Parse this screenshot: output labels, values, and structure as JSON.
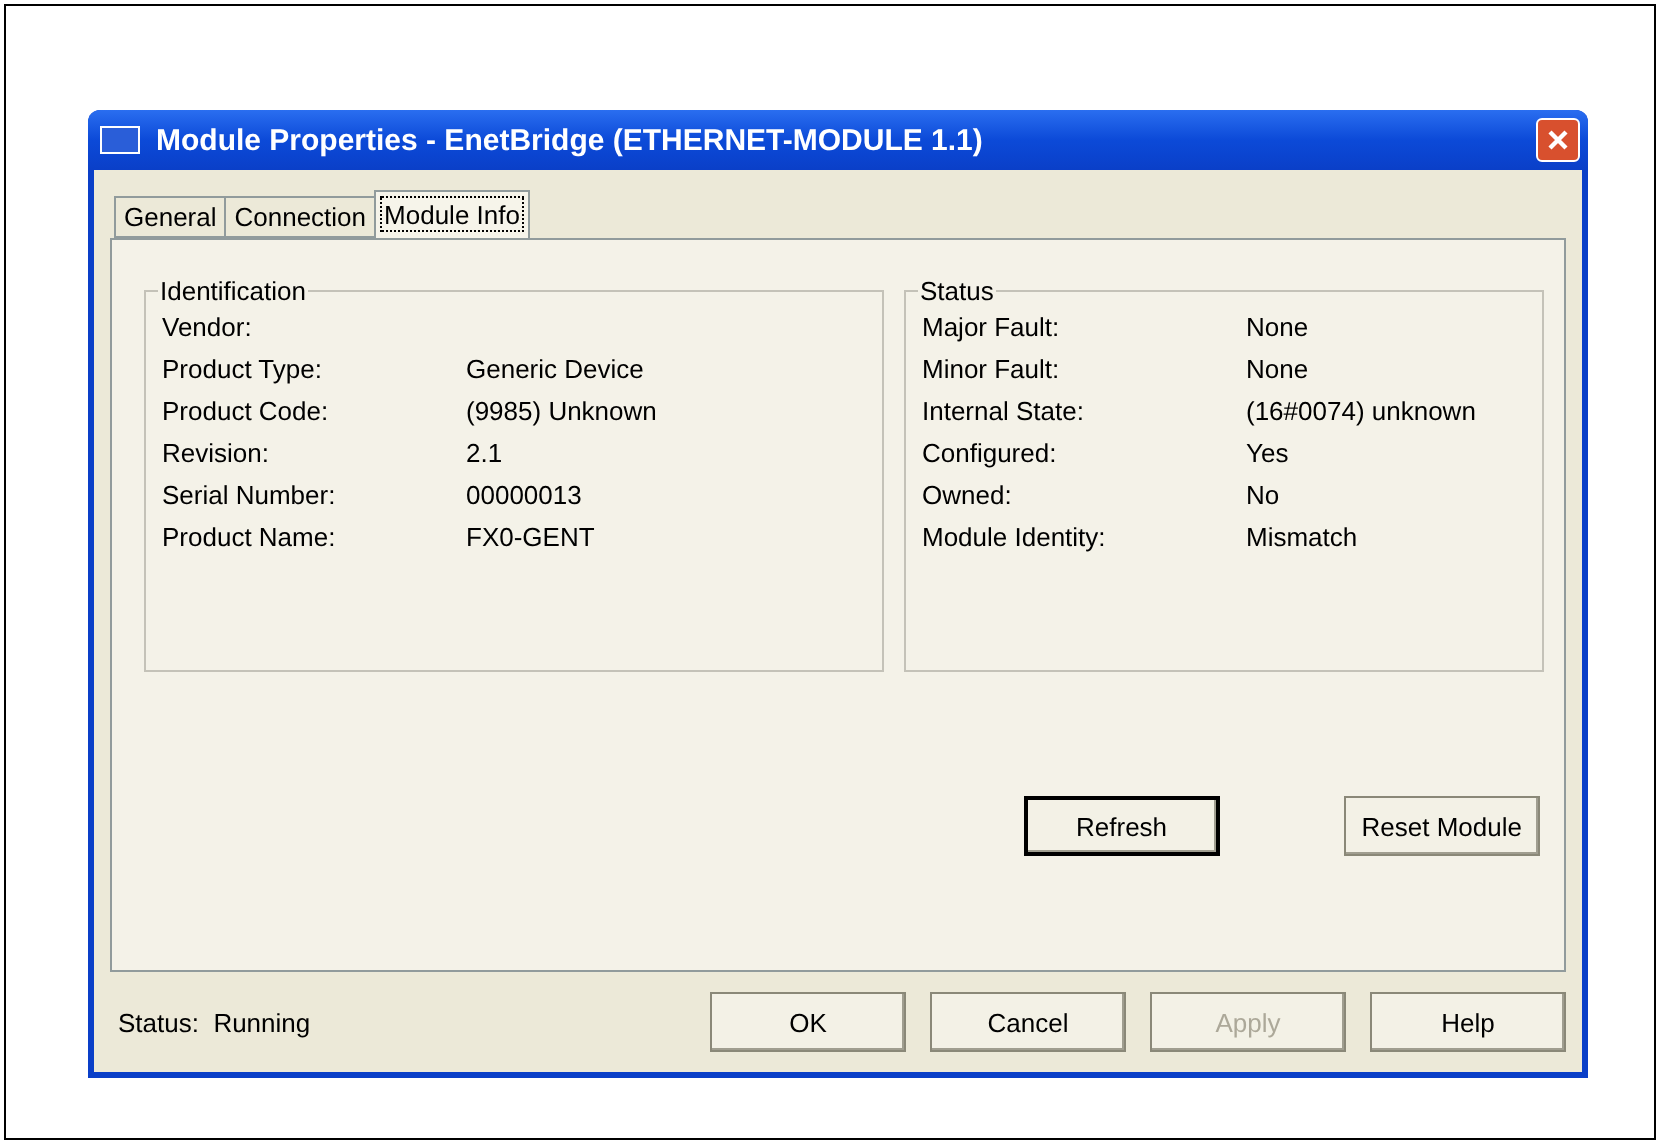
{
  "window": {
    "title": "Module Properties  - EnetBridge (ETHERNET-MODULE 1.1)"
  },
  "tabs": [
    {
      "label": "General",
      "selected": false
    },
    {
      "label": "Connection",
      "selected": false
    },
    {
      "label": "Module Info",
      "selected": true
    }
  ],
  "identification": {
    "title": "Identification",
    "rows": [
      {
        "label": "Vendor:"
      },
      {
        "label": "Product Type:",
        "value": "Generic Device"
      },
      {
        "label": "Product Code:",
        "value": "(9985) Unknown"
      },
      {
        "label": "Revision:",
        "value": "2.1"
      },
      {
        "label": "Serial Number:",
        "value": "00000013"
      },
      {
        "label": "Product Name:",
        "value": "FX0-GENT"
      }
    ]
  },
  "status": {
    "title": "Status",
    "rows": [
      {
        "label": "Major Fault:",
        "value": "None"
      },
      {
        "label": "Minor Fault:",
        "value": "None"
      },
      {
        "label": "Internal State:",
        "value": "(16#0074) unknown"
      },
      {
        "label": "Configured:",
        "value": "Yes"
      },
      {
        "label": "Owned:",
        "value": "No"
      },
      {
        "label": "Module Identity:",
        "value": "Mismatch"
      }
    ]
  },
  "module_buttons": [
    {
      "label": "Refresh",
      "default": true
    },
    {
      "label": "Reset Module",
      "default": false
    }
  ],
  "status_bar": "Status:  Running",
  "buttons": [
    {
      "label": "OK",
      "disabled": false
    },
    {
      "label": "Cancel",
      "disabled": false
    },
    {
      "label": "Apply",
      "disabled": true
    },
    {
      "label": "Help",
      "disabled": false
    }
  ]
}
